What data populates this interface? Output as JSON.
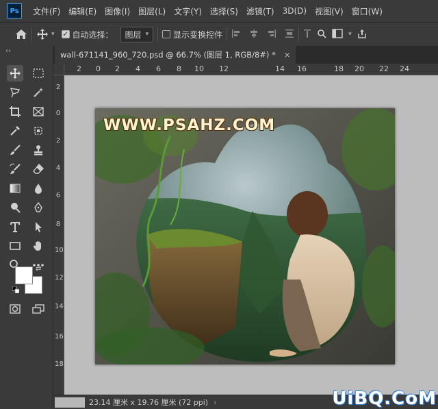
{
  "menu": {
    "logo": "Ps",
    "items": [
      "文件(F)",
      "编辑(E)",
      "图像(I)",
      "图层(L)",
      "文字(Y)",
      "选择(S)",
      "滤镜(T)",
      "3D(D)",
      "视图(V)",
      "窗口(W)"
    ]
  },
  "options": {
    "auto_select_label": "自动选择：",
    "auto_select_checked": true,
    "auto_select_target": "图层",
    "show_transform_label": "显示变换控件",
    "show_transform_checked": false
  },
  "document_tab": {
    "title": "wall-671141_960_720.psd @ 66.7% (图层 1, RGB/8#) *",
    "close": "×"
  },
  "ruler_top": [
    "2",
    "0",
    "2",
    "4",
    "6",
    "8",
    "10",
    "12",
    "14",
    "16",
    "18",
    "20",
    "22",
    "24"
  ],
  "ruler_left": [
    "2",
    "0",
    "2",
    "4",
    "6",
    "8",
    "10",
    "12",
    "14",
    "16",
    "18"
  ],
  "image": {
    "watermark_text": "WWW.PSAHZ.COM"
  },
  "status": {
    "doc_size": "23.14 厘米 x 19.76 厘米 (72 ppi)",
    "arrow": "›"
  },
  "site_watermark": "UiBQ.CoM",
  "colors": {
    "foreground": "#ffffff",
    "background": "#ffffff",
    "accent": "#31a8ff"
  }
}
